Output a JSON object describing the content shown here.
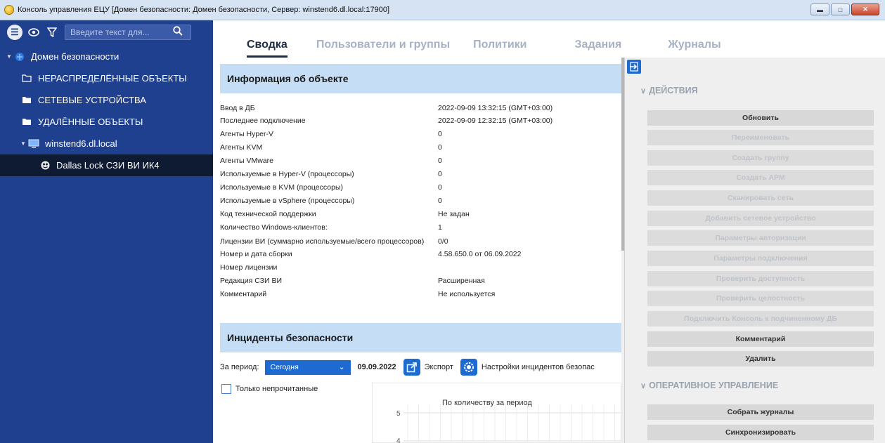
{
  "window": {
    "title": "Консоль управления ЕЦУ [Домен безопасности: Домен безопасности, Сервер: winstend6.dl.local:17900]",
    "minimize": "▬",
    "maximize": "□",
    "close": "✕"
  },
  "sidebar": {
    "search_placeholder": "Введите текст для...",
    "tree": [
      {
        "label": "Домен безопасности",
        "icon": "domain-icon",
        "expanded": true
      },
      {
        "label": "НЕРАСПРЕДЕЛЁННЫЕ ОБЪЕКТЫ",
        "icon": "folder-outline-icon"
      },
      {
        "label": "СЕТЕВЫЕ УСТРОЙСТВА",
        "icon": "folder-icon"
      },
      {
        "label": "УДАЛЁННЫЕ ОБЪЕКТЫ",
        "icon": "folder-icon"
      },
      {
        "label": "winstend6.dl.local",
        "icon": "computer-icon",
        "expanded": true
      },
      {
        "label": "Dallas Lock СЗИ ВИ ИК4",
        "icon": "dallas-lock-icon",
        "selected": true
      }
    ]
  },
  "tabs": [
    {
      "label": "Сводка",
      "active": true
    },
    {
      "label": "Пользователи и группы"
    },
    {
      "label": "Политики"
    },
    {
      "label": "Задания"
    },
    {
      "label": "Журналы"
    }
  ],
  "object_info": {
    "title": "Информация об объекте",
    "rows": [
      {
        "key": "Ввод в ДБ",
        "value": "2022-09-09 13:32:15 (GMT+03:00)"
      },
      {
        "key": "Последнее подключение",
        "value": "2022-09-09 12:32:15 (GMT+03:00)"
      },
      {
        "key": "Агенты Hyper-V",
        "value": "0"
      },
      {
        "key": "Агенты KVM",
        "value": "0"
      },
      {
        "key": "Агенты VMware",
        "value": "0"
      },
      {
        "key": "Используемые в Hyper-V (процессоры)",
        "value": "0"
      },
      {
        "key": "Используемые в KVM (процессоры)",
        "value": "0"
      },
      {
        "key": "Используемые в vSphere (процессоры)",
        "value": "0"
      },
      {
        "key": "Код технической поддержки",
        "value": "Не задан"
      },
      {
        "key": "Количество Windows-клиентов:",
        "value": "1"
      },
      {
        "key": "Лицензии ВИ (суммарно используемые/всего процессоров)",
        "value": "0/0"
      },
      {
        "key": "Номер и дата сборки",
        "value": "4.58.650.0 от 06.09.2022"
      },
      {
        "key": "Номер лицензии",
        "value": ""
      },
      {
        "key": "Редакция СЗИ ВИ",
        "value": "Расширенная"
      },
      {
        "key": "Комментарий",
        "value": "Не используется"
      }
    ]
  },
  "incidents": {
    "title": "Инциденты безопасности",
    "period_label": "За период:",
    "period_value": "Сегодня",
    "date": "09.09.2022",
    "export_label": "Экспорт",
    "settings_label": "Настройки инцидентов безопас",
    "only_unread_label": "Только непрочитанные",
    "chart": {
      "title": "По количеству за период",
      "y_ticks": [
        "5",
        "4"
      ]
    }
  },
  "actions_panel": {
    "groups": [
      {
        "title": "ДЕЙСТВИЯ",
        "buttons": [
          {
            "label": "Обновить",
            "enabled": true
          },
          {
            "label": "Переименовать",
            "enabled": false
          },
          {
            "label": "Создать группу",
            "enabled": false
          },
          {
            "label": "Создать АРМ",
            "enabled": false
          },
          {
            "label": "Сканировать сеть",
            "enabled": false
          },
          {
            "label": "Добавить сетевое устройство",
            "enabled": false
          },
          {
            "label": "Параметры авторизации",
            "enabled": false
          },
          {
            "label": "Параметры подключения",
            "enabled": false
          },
          {
            "label": "Проверить доступность",
            "enabled": false
          },
          {
            "label": "Проверить целостность",
            "enabled": false
          },
          {
            "label": "Подключить Консоль к подчиненному ДБ",
            "enabled": false
          },
          {
            "label": "Комментарий",
            "enabled": true
          },
          {
            "label": "Удалить",
            "enabled": true
          }
        ]
      },
      {
        "title": "ОПЕРАТИВНОЕ УПРАВЛЕНИЕ",
        "buttons": [
          {
            "label": "Собрать журналы",
            "enabled": true
          },
          {
            "label": "Синхронизировать",
            "enabled": true
          }
        ]
      }
    ]
  },
  "colors": {
    "sidebar_bg": "#1f3f8f",
    "accent_blue": "#1d6bd1",
    "section_header_bg": "#c5ddf5",
    "actions_bg": "#efefef"
  }
}
